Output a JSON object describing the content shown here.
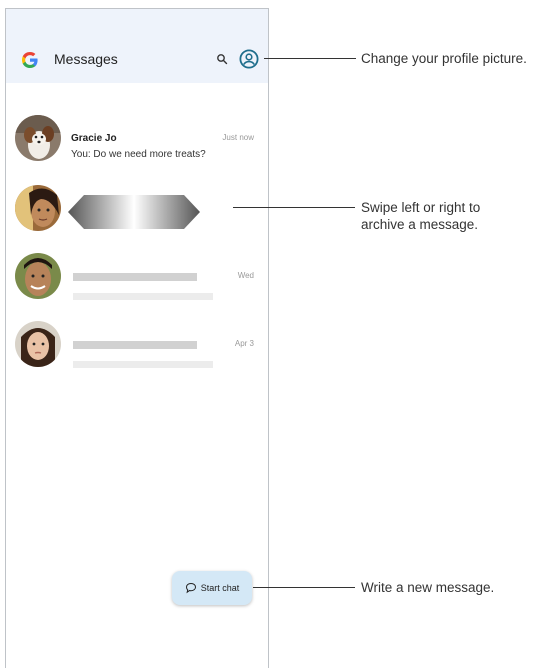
{
  "app": {
    "title": "Messages"
  },
  "colors": {
    "appbar": "#eef3fb",
    "fab": "#d4e8f6",
    "profile_icon": "#1f6e8c"
  },
  "icons": [
    "google-g-icon",
    "search-icon",
    "account-circle-icon",
    "chat-bubble-icon"
  ],
  "conversations": [
    {
      "name": "Gracie Jo",
      "preview": "You: Do we need more treats?",
      "time": "Just now"
    },
    {
      "name": "",
      "preview": "",
      "time": ""
    },
    {
      "name": "",
      "preview": "",
      "time": "Wed"
    },
    {
      "name": "",
      "preview": "",
      "time": "Apr 3"
    }
  ],
  "fab": {
    "label": "Start chat"
  },
  "callouts": {
    "profile": "Change your profile picture.",
    "swipe_line1": "Swipe left or right to",
    "swipe_line2": "archive a message.",
    "new_message": "Write a new message."
  }
}
